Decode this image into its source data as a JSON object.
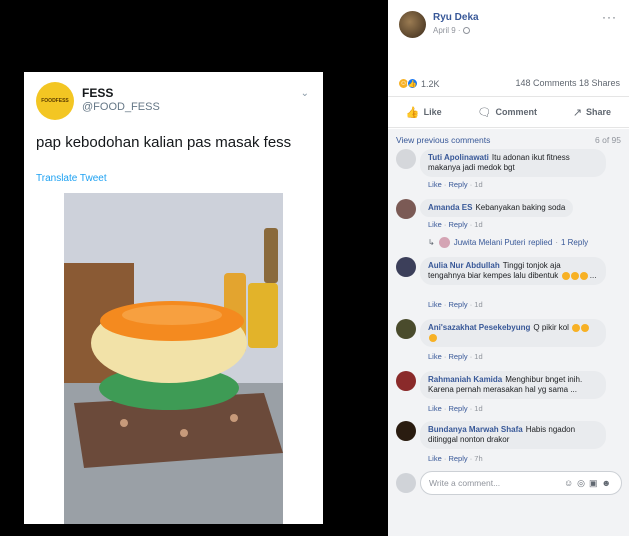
{
  "tweet": {
    "avatar_text": "FOODFESS",
    "name": "FESS",
    "handle": "@FOOD_FESS",
    "chevron": "⌄",
    "text": "pap kebodohan kalian pas masak fess",
    "translate": "Translate Tweet"
  },
  "post": {
    "poster_name": "Ryu Deka",
    "date": "April 9 ·",
    "more": "···",
    "reaction_count": "1.2K",
    "comments_shares": "148 Comments  18 Shares",
    "actions": {
      "like": "Like",
      "comment": "Comment",
      "share": "Share"
    }
  },
  "comments": {
    "view_previous": "View previous comments",
    "count": "6 of 95",
    "items": [
      {
        "author": "Tuti Apolinawati",
        "text": "Itu adonan ikut fitness makanya jadi medok bgt",
        "meta_like": "Like",
        "meta_reply": "Reply",
        "meta_time": "1d"
      },
      {
        "author": "Amanda ES",
        "text": "Kebanyakan baking soda",
        "meta_like": "Like",
        "meta_reply": "Reply",
        "meta_time": "1d"
      },
      {
        "author": "Aulia Nur Abdullah",
        "text": "Tinggi tonjok aja tengahnya biar kempes lalu dibentuk",
        "meta_like": "Like",
        "meta_reply": "Reply",
        "meta_time": "1d"
      },
      {
        "author": "Ani'sazakhat Pesekebyung",
        "text": "Q pikir kol",
        "meta_like": "Like",
        "meta_reply": "Reply",
        "meta_time": "1d"
      },
      {
        "author": "Rahmaniah Kamida",
        "text": "Menghibur bnget inih. Karena pernah merasakan hal yg sama ...",
        "meta_like": "Like",
        "meta_reply": "Reply",
        "meta_time": "1d"
      },
      {
        "author": "Bundanya Marwah Shafa",
        "text": "Habis ngadon ditinggal nonton drakor",
        "meta_like": "Like",
        "meta_reply": "Reply",
        "meta_time": "7h"
      }
    ],
    "reply": {
      "author": "Juwita Melani Puteri",
      "action": "replied",
      "count": "1 Reply"
    }
  },
  "write": {
    "placeholder": "Write a comment..."
  }
}
